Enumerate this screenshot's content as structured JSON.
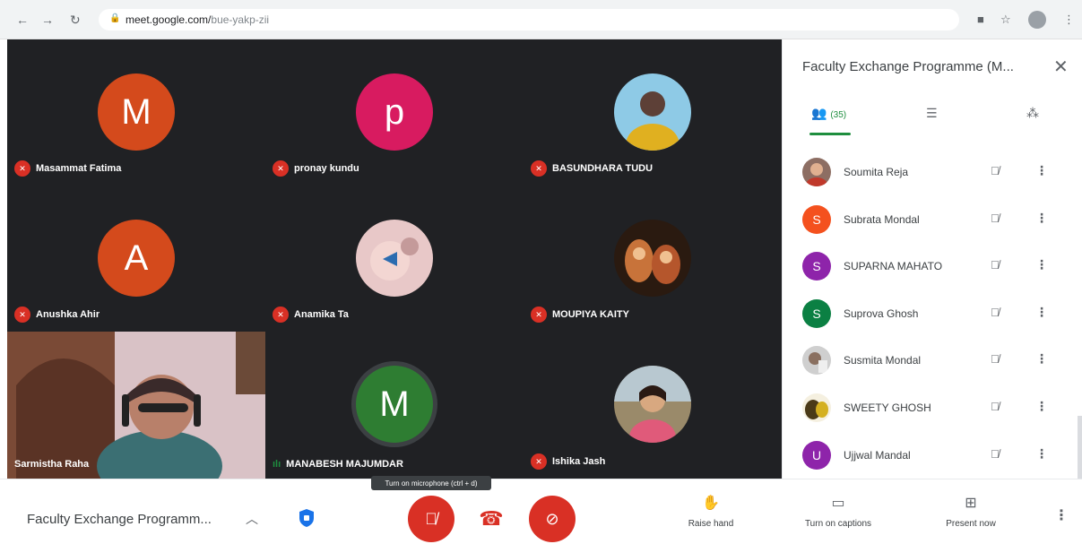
{
  "browser": {
    "url_host": "meet.google.com/",
    "url_path": "bue-yakp-zii"
  },
  "grid": {
    "tiles": [
      {
        "name": "Masammat Fatima",
        "initial": "M",
        "color": "#d44a1c"
      },
      {
        "name": "pronay kundu",
        "initial": "p",
        "color": "#d81b60"
      },
      {
        "name": "BASUNDHARA TUDU"
      },
      {
        "name": "Anushka Ahir",
        "initial": "A",
        "color": "#d44a1c"
      },
      {
        "name": "Anamika Ta"
      },
      {
        "name": "MOUPIYA KAITY"
      },
      {
        "name": "Sarmistha Raha"
      },
      {
        "name": "MANABESH MAJUMDAR",
        "initial": "M",
        "color": "#2e7d32"
      },
      {
        "name": "Ishika Jash"
      }
    ]
  },
  "panel": {
    "title": "Faculty Exchange Programme (M...",
    "people_count": "(35)",
    "participants": [
      {
        "name": "Soumita Reja",
        "initial": "",
        "color": "#8d6e63"
      },
      {
        "name": "Subrata Mondal",
        "initial": "S",
        "color": "#f4511e"
      },
      {
        "name": "SUPARNA MAHATO",
        "initial": "S",
        "color": "#8e24aa"
      },
      {
        "name": "Suprova Ghosh",
        "initial": "S",
        "color": "#0b8043"
      },
      {
        "name": "Susmita Mondal",
        "initial": "",
        "color": "#bdbdbd"
      },
      {
        "name": "SWEETY GHOSH",
        "initial": "",
        "color": "#6d4c41"
      },
      {
        "name": "Ujjwal Mandal",
        "initial": "U",
        "color": "#8e24aa"
      }
    ]
  },
  "bottom": {
    "meeting_title": "Faculty Exchange Programm...",
    "tooltip": "Turn on microphone (ctrl + d)",
    "raise_hand": "Raise hand",
    "captions": "Turn on captions",
    "present": "Present now"
  },
  "colors": {
    "accent_green": "#1e8e3e",
    "danger_red": "#d93025",
    "grid_bg": "#202124"
  }
}
